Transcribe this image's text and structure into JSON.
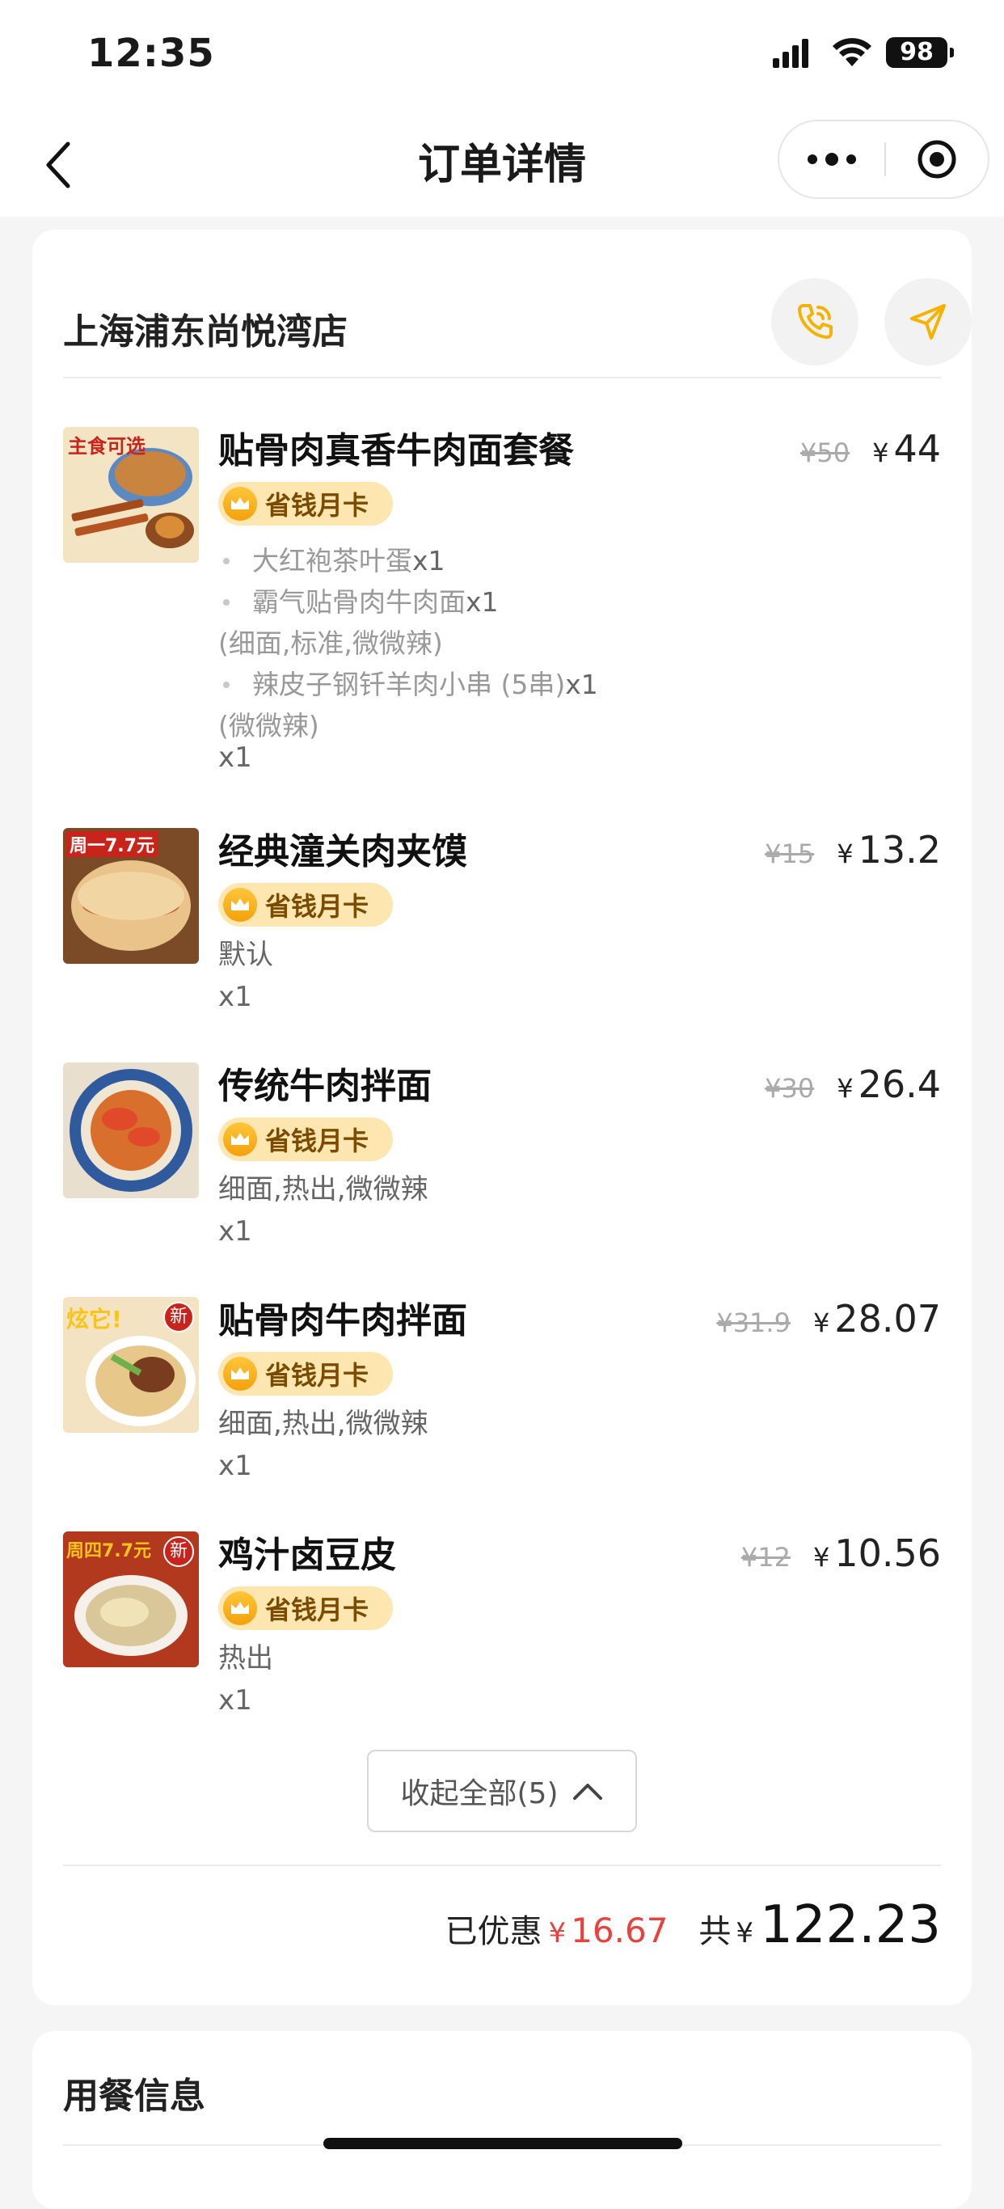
{
  "status_bar": {
    "time": "12:35",
    "battery": "98"
  },
  "nav": {
    "title": "订单详情",
    "icons": [
      "back-chevron-icon",
      "more-dots-icon",
      "target-close-icon"
    ]
  },
  "store": {
    "name": "上海浦东尚悦湾店",
    "icons": [
      "phone-icon",
      "navigation-arrow-icon"
    ]
  },
  "badge_label": "省钱月卡",
  "items": [
    {
      "name": "贴骨肉真香牛肉面套餐",
      "old_price": "¥50",
      "yen": "¥",
      "price": "44",
      "thumb_caption": "主食可选",
      "sub_items": [
        {
          "name": "大红袍茶叶蛋",
          "qty": "x1"
        },
        {
          "name": "霸气贴骨肉牛肉面",
          "qty": "x1",
          "options": "(细面,标准,微微辣)"
        },
        {
          "name": "辣皮子钢钎羊肉小串 (5串)",
          "qty": "x1",
          "options": "(微微辣)"
        }
      ],
      "qty": "x1"
    },
    {
      "name": "经典潼关肉夹馍",
      "old_price": "¥15",
      "yen": "¥",
      "price": "13.2",
      "thumb_caption": "周一7.7元",
      "spec": "默认",
      "qty": "x1"
    },
    {
      "name": "传统牛肉拌面",
      "old_price": "¥30",
      "yen": "¥",
      "price": "26.4",
      "spec": "细面,热出,微微辣",
      "qty": "x1"
    },
    {
      "name": "贴骨肉牛肉拌面",
      "old_price": "¥31.9",
      "yen": "¥",
      "price": "28.07",
      "thumb_caption": "炫它!",
      "thumb_tag": "新",
      "spec": "细面,热出,微微辣",
      "qty": "x1"
    },
    {
      "name": "鸡汁卤豆皮",
      "old_price": "¥12",
      "yen": "¥",
      "price": "10.56",
      "thumb_caption": "周四7.7元",
      "thumb_tag": "新",
      "spec": "热出",
      "qty": "x1"
    }
  ],
  "collapse": {
    "label": "收起全部(5)"
  },
  "totals": {
    "discount_label": "已优惠",
    "discount_yen": "¥",
    "discount_value": "16.67",
    "sum_label": "共",
    "sum_yen": "¥",
    "sum_value": "122.23"
  },
  "dining_info": {
    "title": "用餐信息"
  },
  "colors": {
    "discount_red": "#e8423f",
    "badge_bg": "#fde6b0",
    "badge_text": "#7a4b00",
    "accent_yellow": "#f5b200"
  }
}
